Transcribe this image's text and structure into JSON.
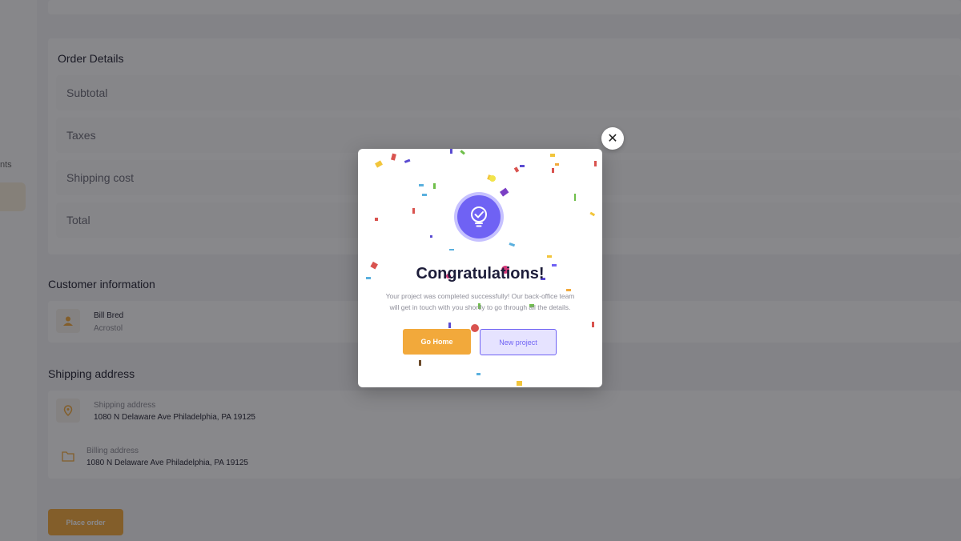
{
  "sidebar": {
    "item_label": "nts"
  },
  "order": {
    "title": "Order Details",
    "rows": [
      "Subtotal",
      "Taxes",
      "Shipping cost",
      "Total"
    ]
  },
  "customer": {
    "title": "Customer information",
    "name": "Bill Bred",
    "company": "Acrostol",
    "icon": "user-icon"
  },
  "shipping": {
    "title": "Shipping address",
    "shipping_label": "Shipping address",
    "shipping_value": "1080 N Delaware Ave Philadelphia, PA 19125",
    "billing_label": "Billing address",
    "billing_value": "1080 N Delaware Ave Philadelphia, PA 19125"
  },
  "place_order_label": "Place order",
  "modal": {
    "title": "Congratulations!",
    "body_line1": "Your project was completed successfully! Our back-office team",
    "body_line2": "will get in touch with you shortly to go through all the details.",
    "go_home_label": "Go Home",
    "new_project_label": "New project",
    "close_label": "✕",
    "badge_icon": "lightbulb-check-icon"
  },
  "colors": {
    "accent": "#f2a93b",
    "primary": "#6f62f4",
    "primary_light": "#e6e3ff"
  }
}
